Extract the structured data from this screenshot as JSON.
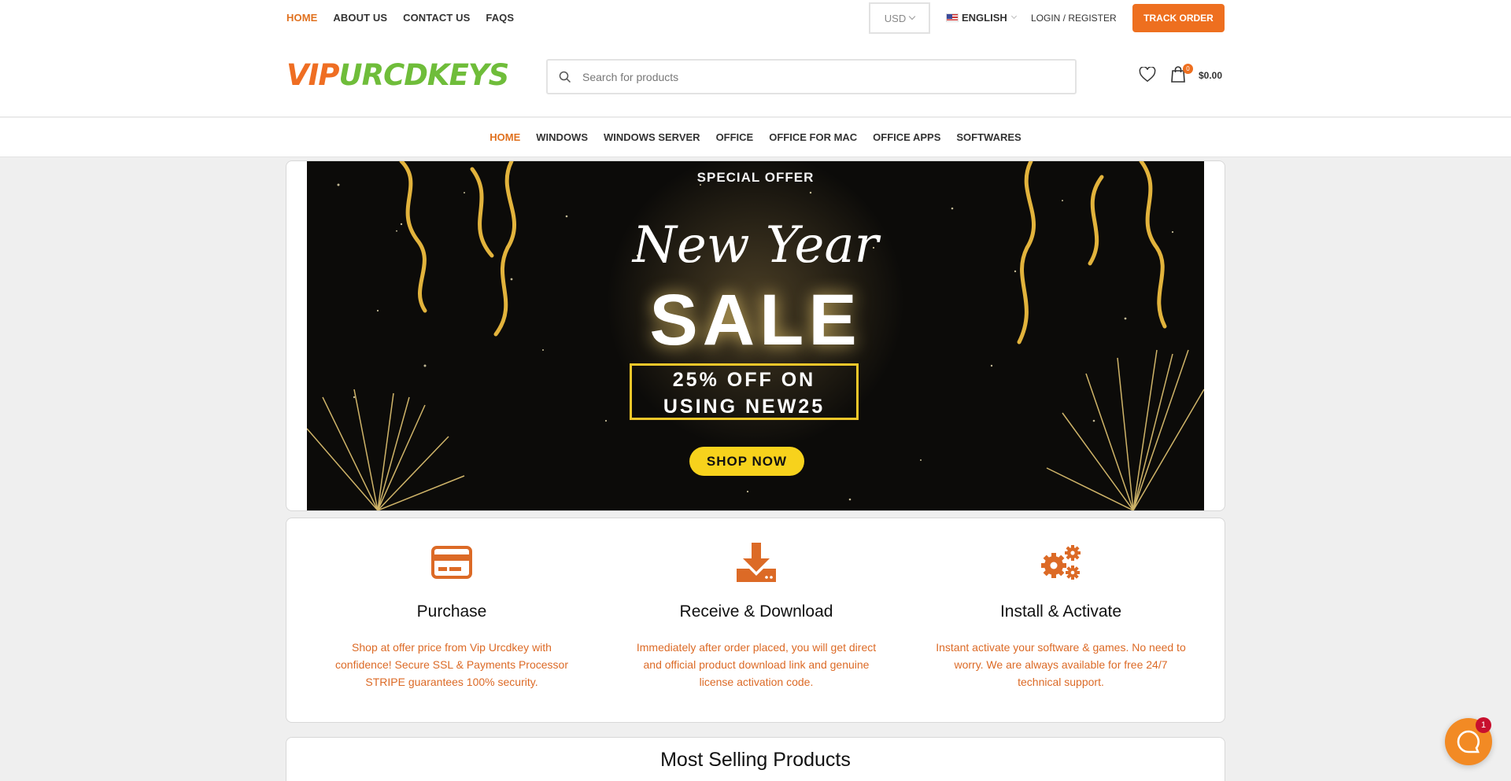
{
  "topbar": {
    "nav": [
      "HOME",
      "ABOUT US",
      "CONTACT US",
      "FAQS"
    ],
    "currency": "USD",
    "language": "ENGLISH",
    "login": "LOGIN / REGISTER",
    "track_order": "TRACK ORDER"
  },
  "header": {
    "logo_part1": "VIP",
    "logo_part2": "URCDKEYS",
    "search_placeholder": "Search for products",
    "cart_count": "0",
    "cart_total": "$0.00"
  },
  "main_nav": [
    "HOME",
    "WINDOWS",
    "WINDOWS SERVER",
    "OFFICE",
    "OFFICE FOR MAC",
    "OFFICE APPS",
    "SOFTWARES"
  ],
  "banner": {
    "special": "SPECIAL OFFER",
    "new_year": "New Year",
    "sale": "SALE",
    "offer_line1": "25% OFF ON",
    "offer_line2": "USING NEW25",
    "cta": "SHOP NOW"
  },
  "features": [
    {
      "icon": "credit-card-icon",
      "title": "Purchase",
      "text": "Shop at offer price from Vip Urcdkey with confidence! Secure SSL & Payments Processor STRIPE guarantees 100% security."
    },
    {
      "icon": "download-icon",
      "title": "Receive & Download",
      "text": "Immediately after order placed, you will get direct and official product download link and genuine license activation code."
    },
    {
      "icon": "gears-icon",
      "title": "Install & Activate",
      "text": "Instant activate your software & games. No need to worry. We are always available for free 24/7 technical support."
    }
  ],
  "section_title": "Most Selling Products",
  "chat": {
    "badge": "1"
  },
  "colors": {
    "accent": "#ee6f1f",
    "logo_green": "#6fbd3a",
    "feature_text": "#dc6a26",
    "banner_gold": "#f1c72a"
  }
}
